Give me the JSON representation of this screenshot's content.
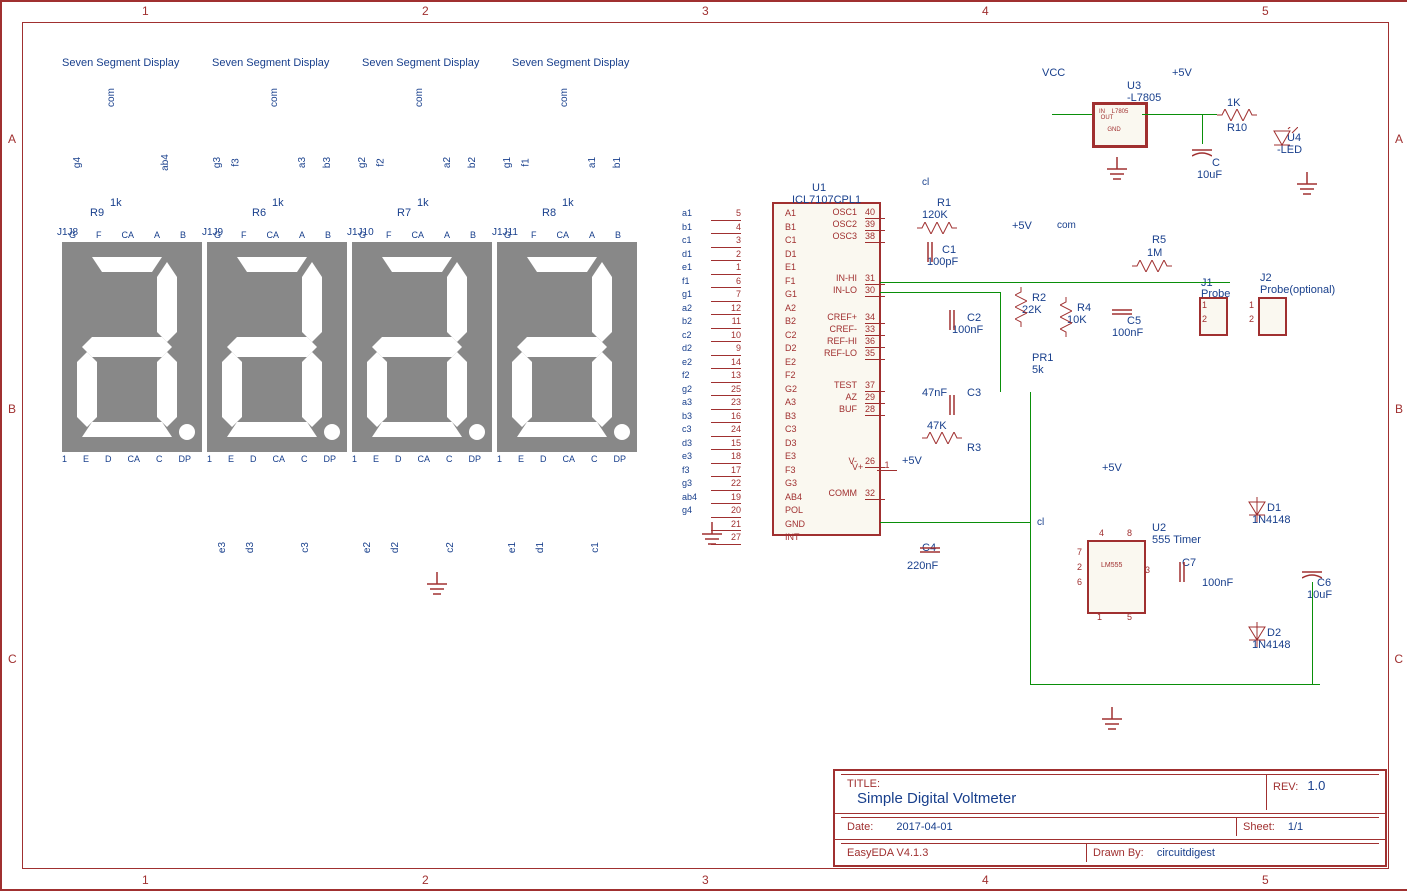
{
  "grid": {
    "cols": [
      "1",
      "2",
      "3",
      "4",
      "5"
    ],
    "rows": [
      "A",
      "B",
      "C"
    ]
  },
  "displays": [
    "Seven Segment Display",
    "Seven Segment Display",
    "Seven Segment Display",
    "Seven Segment Display"
  ],
  "display_conn": [
    "J1J8",
    "J1J9",
    "J1J10",
    "J1J11"
  ],
  "display_res": [
    {
      "ref": "R9",
      "val": "1k"
    },
    {
      "ref": "R6",
      "val": "1k"
    },
    {
      "ref": "R7",
      "val": "1k"
    },
    {
      "ref": "R8",
      "val": "1k"
    }
  ],
  "display_nets_top": [
    [
      "g4",
      "com",
      "ab4"
    ],
    [
      "g3",
      "f3",
      "com",
      "a3",
      "b3"
    ],
    [
      "g2",
      "f2",
      "com",
      "a2",
      "b2"
    ],
    [
      "g1",
      "f1",
      "com",
      "a1",
      "b1"
    ]
  ],
  "display_nets_bottom": [
    [
      "e3",
      "d3",
      "c3"
    ],
    [
      "e2",
      "d2",
      "c2"
    ],
    [
      "e1",
      "d1",
      "c1"
    ]
  ],
  "display_pins_top": [
    "G",
    "F",
    "CA",
    "A",
    "B"
  ],
  "display_pins_bottom": [
    "1",
    "E",
    "D",
    "CA",
    "C",
    "DP"
  ],
  "ic": {
    "ref": "U1",
    "part": "ICL7107CPL1",
    "left_pins": [
      {
        "n": "5",
        "name": "A1",
        "net": "a1"
      },
      {
        "n": "4",
        "name": "B1",
        "net": "b1"
      },
      {
        "n": "3",
        "name": "C1",
        "net": "c1"
      },
      {
        "n": "2",
        "name": "D1",
        "net": "d1"
      },
      {
        "n": "1",
        "name": "E1",
        "net": "e1"
      },
      {
        "n": "6",
        "name": "F1",
        "net": "f1"
      },
      {
        "n": "7",
        "name": "G1",
        "net": "g1"
      },
      {
        "n": "12",
        "name": "A2",
        "net": "a2"
      },
      {
        "n": "11",
        "name": "B2",
        "net": "b2"
      },
      {
        "n": "10",
        "name": "C2",
        "net": "c2"
      },
      {
        "n": "9",
        "name": "D2",
        "net": "d2"
      },
      {
        "n": "14",
        "name": "E2",
        "net": "e2"
      },
      {
        "n": "13",
        "name": "F2",
        "net": "f2"
      },
      {
        "n": "25",
        "name": "G2",
        "net": "g2"
      },
      {
        "n": "23",
        "name": "A3",
        "net": "a3"
      },
      {
        "n": "16",
        "name": "B3",
        "net": "b3"
      },
      {
        "n": "24",
        "name": "C3",
        "net": "c3"
      },
      {
        "n": "15",
        "name": "D3",
        "net": "d3"
      },
      {
        "n": "18",
        "name": "E3",
        "net": "e3"
      },
      {
        "n": "17",
        "name": "F3",
        "net": "f3"
      },
      {
        "n": "22",
        "name": "G3",
        "net": "g3"
      },
      {
        "n": "19",
        "name": "AB4",
        "net": "ab4"
      },
      {
        "n": "20",
        "name": "POL",
        "net": "g4"
      },
      {
        "n": "21",
        "name": "GND",
        "net": ""
      },
      {
        "n": "27",
        "name": "INT",
        "net": ""
      }
    ],
    "right_pins": [
      {
        "n": "40",
        "name": "OSC1"
      },
      {
        "n": "39",
        "name": "OSC2"
      },
      {
        "n": "38",
        "name": "OSC3"
      },
      {
        "n": "31",
        "name": "IN-HI"
      },
      {
        "n": "30",
        "name": "IN-LO"
      },
      {
        "n": "34",
        "name": "CREF+"
      },
      {
        "n": "33",
        "name": "CREF-"
      },
      {
        "n": "36",
        "name": "REF-HI"
      },
      {
        "n": "35",
        "name": "REF-LO"
      },
      {
        "n": "37",
        "name": "TEST"
      },
      {
        "n": "29",
        "name": "AZ"
      },
      {
        "n": "28",
        "name": "BUF"
      },
      {
        "n": "26",
        "name": "V-"
      },
      {
        "n": "32",
        "name": "COMM"
      }
    ],
    "vplus": "V+"
  },
  "components": {
    "R1": {
      "ref": "R1",
      "val": "120K"
    },
    "R2": {
      "ref": "R2",
      "val": "22K"
    },
    "R3": {
      "ref": "R3",
      "val": "47K"
    },
    "R4": {
      "ref": "R4",
      "val": "10K"
    },
    "R5": {
      "ref": "R5",
      "val": "1M"
    },
    "R10": {
      "ref": "R10",
      "val": "1K"
    },
    "C1": {
      "ref": "C1",
      "val": "100pF"
    },
    "C2": {
      "ref": "C2",
      "val": "100nF"
    },
    "C3": {
      "ref": "C3",
      "val": "47nF"
    },
    "C4": {
      "ref": "C4",
      "val": "220nF"
    },
    "C5": {
      "ref": "C5",
      "val": "100nF"
    },
    "C6": {
      "ref": "C6",
      "val": "10uF"
    },
    "C7": {
      "ref": "C7",
      "val": "100nF"
    },
    "C": {
      "ref": "C",
      "val": "10uF"
    },
    "PR1": {
      "ref": "PR1",
      "val": "5k"
    },
    "D1": {
      "ref": "D1",
      "val": "1N4148"
    },
    "D2": {
      "ref": "D2",
      "val": "1N4148"
    },
    "U2": {
      "ref": "U2",
      "val": "555 Timer",
      "part": "LM555"
    },
    "U3": {
      "ref": "U3",
      "val": "-L7805",
      "part": "L7805"
    },
    "U4": {
      "ref": "U4",
      "val": "-LED"
    },
    "J1": {
      "ref": "J1",
      "val": "Probe"
    },
    "J2": {
      "ref": "J2",
      "val": "Probe(optional)"
    }
  },
  "power": {
    "vcc": "VCC",
    "v5": "+5V",
    "com": "com",
    "cl": "cl"
  },
  "u2_pins": {
    "p1": "1",
    "p2": "2",
    "p3": "3",
    "p4": "4",
    "p5": "5",
    "p6": "6",
    "p7": "7",
    "p8": "8"
  },
  "u3_pins": {
    "in": "IN",
    "out": "OUT",
    "gnd": "GND"
  },
  "j_pins": {
    "p1": "1",
    "p2": "2"
  },
  "title_block": {
    "title_label": "TITLE:",
    "title": "Simple Digital Voltmeter",
    "rev_label": "REV:",
    "rev": "1.0",
    "date_label": "Date:",
    "date": "2017-04-01",
    "sheet_label": "Sheet:",
    "sheet": "1/1",
    "tool": "EasyEDA V4.1.3",
    "drawn_label": "Drawn By:",
    "drawn": "circuitdigest"
  }
}
